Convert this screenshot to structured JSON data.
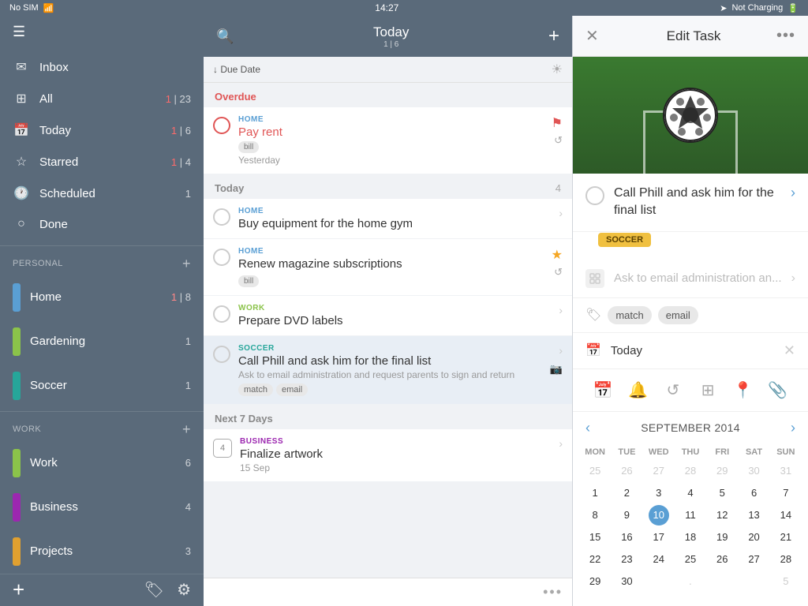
{
  "statusBar": {
    "left": "No SIM ☆",
    "time": "14:27",
    "right": "Not Charging"
  },
  "sidebar": {
    "menuIcon": "☰",
    "items": [
      {
        "id": "inbox",
        "icon": "✉",
        "label": "Inbox",
        "count": ""
      },
      {
        "id": "all",
        "icon": "⊞",
        "label": "All",
        "count1": "1",
        "count2": "23"
      },
      {
        "id": "today",
        "icon": "📅",
        "label": "Today",
        "count1": "1",
        "count2": "6"
      },
      {
        "id": "starred",
        "icon": "☆",
        "label": "Starred",
        "count1": "1",
        "count2": "4"
      },
      {
        "id": "scheduled",
        "icon": "🕐",
        "label": "Scheduled",
        "count": "1"
      },
      {
        "id": "done",
        "icon": "○",
        "label": "Done",
        "count": ""
      }
    ],
    "personalGroup": "PERSONAL",
    "personalItems": [
      {
        "id": "home",
        "label": "Home",
        "color": "#5a9fd4",
        "count1": "1",
        "count2": "8"
      },
      {
        "id": "gardening",
        "label": "Gardening",
        "color": "#8bc34a",
        "count": "1"
      },
      {
        "id": "soccer",
        "label": "Soccer",
        "color": "#26a69a",
        "count": "1"
      }
    ],
    "workGroup": "WORK",
    "workItems": [
      {
        "id": "work",
        "label": "Work",
        "color": "#8bc34a",
        "count": "6"
      },
      {
        "id": "business",
        "label": "Business",
        "color": "#9c27b0",
        "count": "4"
      },
      {
        "id": "projects",
        "label": "Projects",
        "color": "#e0a030",
        "count": "3"
      }
    ]
  },
  "taskList": {
    "title": "Today",
    "subtitle": "1 | 6",
    "sortLabel": "Due Date",
    "sections": {
      "overdue": {
        "label": "Overdue",
        "tasks": [
          {
            "id": "pay-rent",
            "category": "HOME",
            "title": "Pay rent",
            "badge": "bill",
            "date": "Yesterday",
            "flag": "red",
            "hasRepeat": true
          }
        ]
      },
      "today": {
        "label": "Today",
        "count": "4",
        "tasks": [
          {
            "id": "buy-equipment",
            "category": "HOME",
            "title": "Buy equipment for the home gym",
            "hasChevron": true
          },
          {
            "id": "renew-magazine",
            "category": "HOME",
            "title": "Renew magazine subscriptions",
            "badge": "bill",
            "flag": "yellow",
            "hasRepeat": true
          },
          {
            "id": "prepare-dvd",
            "category": "WORK",
            "title": "Prepare DVD labels",
            "hasChevron": true
          },
          {
            "id": "call-phill",
            "category": "SOCCER",
            "title": "Call Phill and ask him for the final list",
            "subtitle": "Ask to email administration and request parents to sign and return",
            "tags": [
              "match",
              "email"
            ],
            "hasCamera": true,
            "selected": true
          }
        ]
      },
      "next7days": {
        "label": "Next 7 Days",
        "tasks": [
          {
            "id": "finalize-artwork",
            "category": "BUSINESS",
            "title": "Finalize artwork",
            "date": "15 Sep",
            "dayNumber": "4"
          }
        ]
      }
    }
  },
  "editPanel": {
    "title": "Edit Task",
    "closeLabel": "✕",
    "moreLabel": "•••",
    "taskTitle": "Call Phill and ask him for the final list",
    "soccerTag": "SOCCER",
    "subtaskPlaceholder": "Ask to email administration an...",
    "tags": [
      "match",
      "email"
    ],
    "date": "Today",
    "tools": [
      "📅",
      "🔔",
      "↺",
      "⊞",
      "📍",
      "📎"
    ],
    "calendar": {
      "month": "SEPTEMBER 2014",
      "prevLabel": "‹",
      "nextLabel": "›",
      "dayHeaders": [
        "MON",
        "TUE",
        "WED",
        "THU",
        "FRI",
        "SAT",
        "SUN"
      ],
      "weeks": [
        [
          "25",
          "26",
          "27",
          "28",
          "29",
          "30",
          "31"
        ],
        [
          "1",
          "2",
          "3",
          "4",
          "5",
          "6",
          "7"
        ],
        [
          "8",
          "9",
          "10",
          "11",
          "12",
          "13",
          "14"
        ],
        [
          "15",
          "16",
          "17",
          "18",
          "19",
          "20",
          "21"
        ],
        [
          "22",
          "23",
          "24",
          "25",
          "26",
          "27",
          "28"
        ],
        [
          "29",
          "30",
          "",
          "",
          "",
          "",
          ""
        ]
      ],
      "otherMonthDays": [
        "25",
        "26",
        "27",
        "28",
        "29",
        "30",
        "31"
      ],
      "todayDay": "10"
    }
  }
}
